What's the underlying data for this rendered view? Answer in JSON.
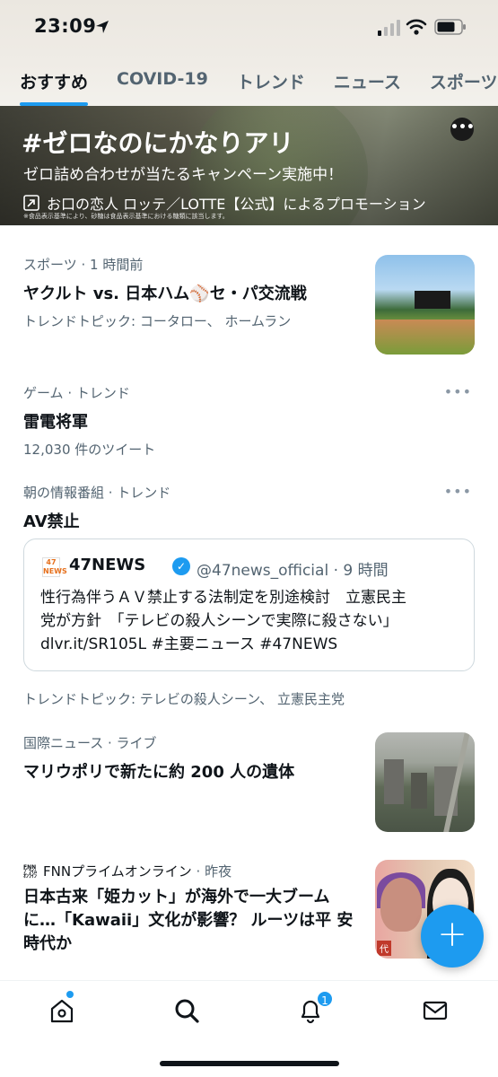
{
  "status_bar": {
    "time": "23:09"
  },
  "tabs": [
    {
      "label": "おすすめ",
      "active": true
    },
    {
      "label": "COVID-19",
      "active": false
    },
    {
      "label": "トレンド",
      "active": false
    },
    {
      "label": "ニュース",
      "active": false
    },
    {
      "label": "スポーツ",
      "active": false
    }
  ],
  "promo": {
    "title": "#ゼロなのにかなりアリ",
    "subtitle": "ゼロ詰め合わせが当たるキャンペーン実施中！",
    "promoted_by": "お口の恋人 ロッテ／LOTTE【公式】によるプロモーション",
    "fine_print": "※食品表示基準により、砂糖は食品表示基準における糖類に該当します。"
  },
  "trends": [
    {
      "meta": "スポーツ · 1 時間前",
      "title": "ヤクルト vs. 日本ハム⚾セ・パ交流戦",
      "extra": "トレンドトピック: コータロー、 ホームラン"
    },
    {
      "meta": "ゲーム · トレンド",
      "title": "雷電将軍",
      "extra": "12,030 件のツイート"
    },
    {
      "meta": "朝の情報番組 · トレンド",
      "title": "AV禁止",
      "extra": "トレンドトピック: テレビの殺人シーン、 立憲民主党"
    },
    {
      "meta": "国際ニュース · ライブ",
      "title": "マリウポリで新たに約 200 人の遺体"
    },
    {
      "source": "FNNプライムオンライン",
      "time": " · 昨夜",
      "title": "日本古来「姫カット」が海外で一大ブーム に…「Kawaii」文化が影響？ ルーツは平 安時代か"
    }
  ],
  "tweet": {
    "avatar_text": "47 NEWS",
    "name": "47NEWS",
    "handle": "@47news_official · 9 時間",
    "body_line1": "性行為伴うＡＶ禁止する法制定を別途検討　立憲民主",
    "body_line2": "党が方針　「テレビの殺人シーンで実際に殺さない」",
    "body_line3": "dlvr.it/SR105L #主要ニュース #47NEWS"
  },
  "thumb_label": "代",
  "fab_label": "+",
  "notifications_count": "1",
  "icons": {
    "location": "location-arrow-icon",
    "signal": "cellular-signal-icon",
    "wifi": "wifi-icon",
    "battery": "battery-icon",
    "more": "more-dots-icon",
    "home": "home-icon",
    "search": "search-icon",
    "bell": "bell-icon",
    "mail": "mail-icon"
  },
  "colors": {
    "accent": "#1d9bf0",
    "text": "#0f1419",
    "secondary": "#536471"
  }
}
